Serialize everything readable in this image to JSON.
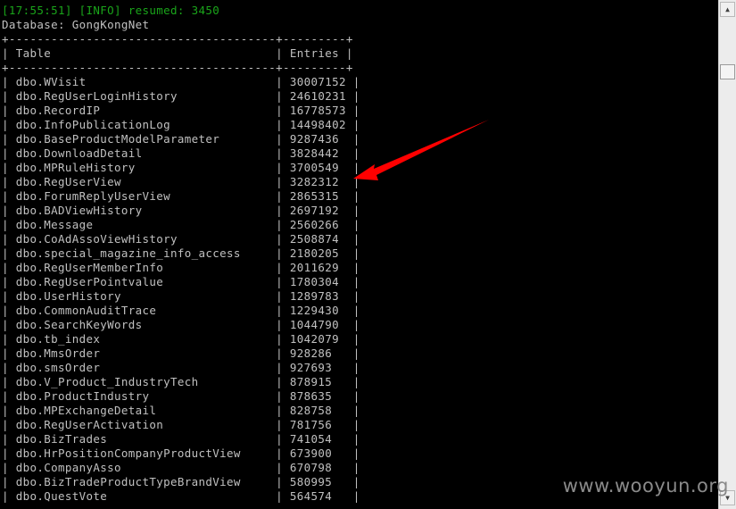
{
  "log": {
    "prefix": "[17:55:51] [INFO] resumed: 3450"
  },
  "database_line": "Database: GongKongNet",
  "table": {
    "border_top": "+--------------------------------------+---------+",
    "header": "| Table                                | Entries |",
    "border_mid": "+--------------------------------------+---------+",
    "rows": [
      "| dbo.WVisit                           | 30007152 |",
      "| dbo.RegUserLoginHistory              | 24610231 |",
      "| dbo.RecordIP                         | 16778573 |",
      "| dbo.InfoPublicationLog               | 14498402 |",
      "| dbo.BaseProductModelParameter        | 9287436  |",
      "| dbo.DownloadDetail                   | 3828442  |",
      "| dbo.MPRuleHistory                    | 3700549  |",
      "| dbo.RegUserView                      | 3282312  |",
      "| dbo.ForumReplyUserView               | 2865315  |",
      "| dbo.BADViewHistory                   | 2697192  |",
      "| dbo.Message                          | 2560266  |",
      "| dbo.CoAdAssoViewHistory              | 2508874  |",
      "| dbo.special_magazine_info_access     | 2180205  |",
      "| dbo.RegUserMemberInfo                | 2011629  |",
      "| dbo.RegUserPointvalue                | 1780304  |",
      "| dbo.UserHistory                      | 1289783  |",
      "| dbo.CommonAuditTrace                 | 1229430  |",
      "| dbo.SearchKeyWords                   | 1044790  |",
      "| dbo.tb_index                         | 1042079  |",
      "| dbo.MmsOrder                         | 928286   |",
      "| dbo.smsOrder                         | 927693   |",
      "| dbo.V_Product_IndustryTech           | 878915   |",
      "| dbo.ProductIndustry                  | 878635   |",
      "| dbo.MPExchangeDetail                 | 828758   |",
      "| dbo.RegUserActivation                | 781756   |",
      "| dbo.BizTrades                        | 741054   |",
      "| dbo.HrPositionCompanyProductView     | 673900   |",
      "| dbo.CompanyAsso                      | 670798   |",
      "| dbo.BizTradeProductTypeBrandView     | 580995   |",
      "| dbo.QuestVote                        | 564574   |"
    ]
  },
  "watermark": "www.wooyun.org",
  "icons": {
    "scroll_up": "triangle-up",
    "scroll_down": "triangle-down",
    "annotation": "red-arrow"
  },
  "colors": {
    "log_text": "#1aa51a",
    "text": "#c0c0c0",
    "arrow": "#ff0000",
    "background": "#000000"
  }
}
